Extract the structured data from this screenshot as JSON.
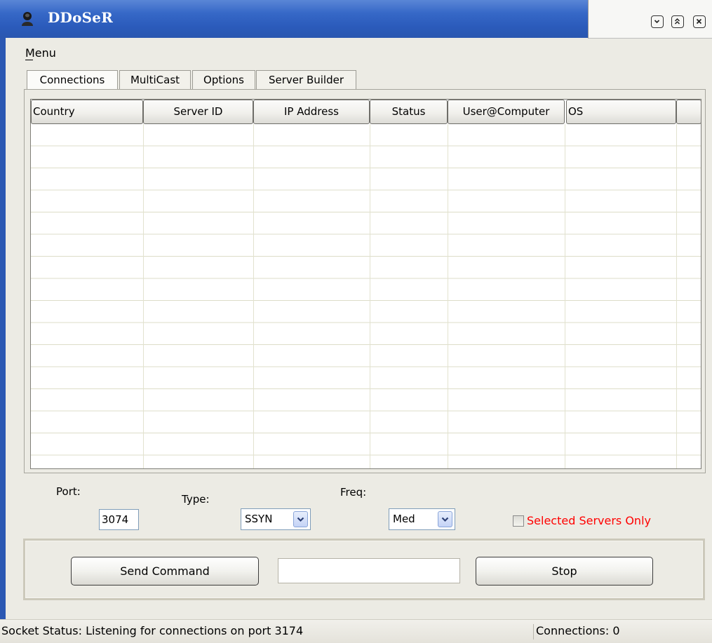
{
  "window": {
    "title": "DDoSeR",
    "controls": [
      "minimize-icon",
      "restore-icon",
      "close-icon"
    ]
  },
  "menubar": {
    "menu_label": "Menu"
  },
  "tabs": [
    {
      "label": "Connections",
      "active": true
    },
    {
      "label": "MultiCast",
      "active": false
    },
    {
      "label": "Options",
      "active": false
    },
    {
      "label": "Server Builder",
      "active": false
    }
  ],
  "grid": {
    "columns": [
      "Country",
      "Server ID",
      "IP Address",
      "Status",
      "User@Computer",
      "OS",
      ""
    ],
    "rows": []
  },
  "controls": {
    "port_label": "Port:",
    "port_value": "3074",
    "type_label": "Type:",
    "type_value": "SSYN",
    "freq_label": "Freq:",
    "freq_value": "Med",
    "selected_only_label": "Selected Servers Only",
    "selected_only_checked": false
  },
  "command": {
    "send_label": "Send Command",
    "input_value": "",
    "stop_label": "Stop"
  },
  "status": {
    "socket_text": "Socket Status: Listening for connections on port 3174",
    "connections_text": "Connections: 0"
  },
  "colors": {
    "title_blue": "#2b5bbb",
    "selected_servers_label": "#ff0000"
  }
}
